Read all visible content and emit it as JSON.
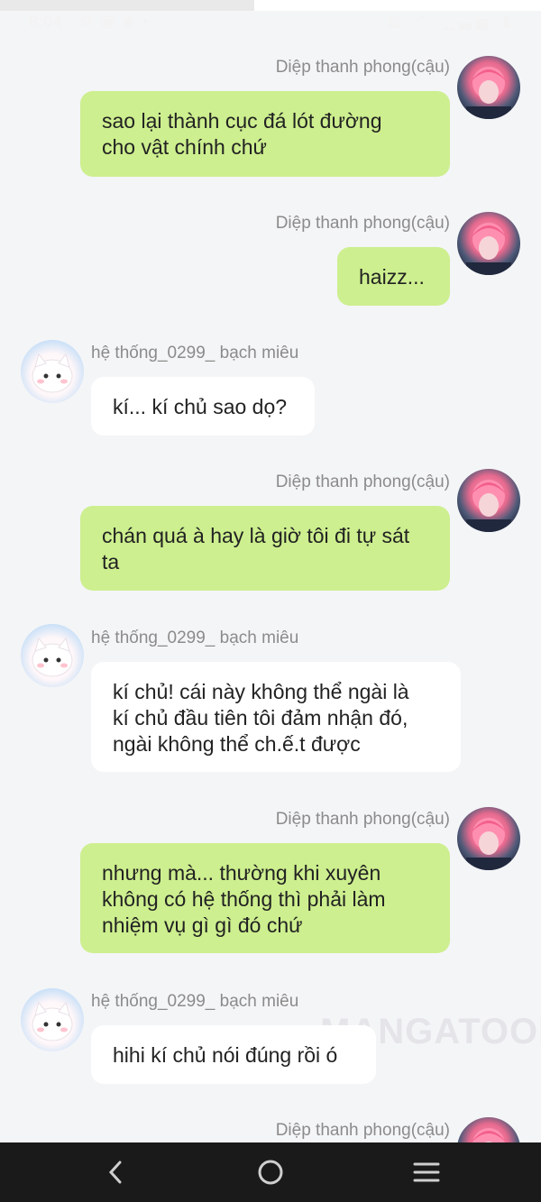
{
  "status_bar": {
    "time": "8:04"
  },
  "messages": [
    {
      "sender": "Diệp thanh phong(cậu)",
      "side": "right",
      "avatar": "boy-avatar",
      "text": "sao lại thành cục đá lót đường cho vật chính chứ",
      "lines": [
        "sao lại thành cục đá lót đường",
        "cho vật chính chứ"
      ]
    },
    {
      "sender": "Diệp thanh phong(cậu)",
      "side": "right",
      "avatar": "boy-avatar",
      "text": "haizz...",
      "lines": [
        "haizz..."
      ]
    },
    {
      "sender": "hệ thống_0299_ bạch miêu",
      "side": "left",
      "avatar": "cat-avatar",
      "text": "kí... kí chủ sao dọ?",
      "lines": [
        "kí... kí chủ sao dọ?"
      ]
    },
    {
      "sender": "Diệp thanh phong(cậu)",
      "side": "right",
      "avatar": "boy-avatar",
      "text": "chán quá à hay là giờ tôi đi tự sát ta",
      "lines": [
        "chán quá à hay là giờ tôi đi tự sát",
        "ta"
      ]
    },
    {
      "sender": "hệ thống_0299_ bạch miêu",
      "side": "left",
      "avatar": "cat-avatar",
      "text": "kí chủ! cái này không thể ngài là kí chủ đầu tiên tôi đảm nhận đó, ngài không thể ch.ế.t được",
      "lines": [
        "kí chủ! cái này không thể ngài là",
        "kí chủ đầu tiên tôi đảm nhận đó,",
        "ngài không thể ch.ế.t được"
      ]
    },
    {
      "sender": "Diệp thanh phong(cậu)",
      "side": "right",
      "avatar": "boy-avatar",
      "text": "nhưng mà... thường khi xuyên không có hệ thống thì phải làm nhiệm vụ gì gì đó chứ",
      "lines": [
        "nhưng mà... thường khi xuyên",
        "không có hệ thống thì phải làm",
        "nhiệm vụ gì gì đó chứ"
      ]
    },
    {
      "sender": "hệ thống_0299_ bạch miêu",
      "side": "left",
      "avatar": "cat-avatar",
      "text": "hihi kí chủ nói đúng rồi ó",
      "lines": [
        "hihi kí chủ nói đúng rồi ó"
      ]
    },
    {
      "sender": "Diệp thanh phong(cậu)",
      "side": "right",
      "avatar": "boy-avatar",
      "text": "",
      "lines": []
    }
  ],
  "watermark": "MANGATOON",
  "colors": {
    "my_bubble": "#cdef8f",
    "their_bubble": "#ffffff",
    "background": "#f4f5f7",
    "nav_bar": "#1a1a1a"
  },
  "nav_bar": {
    "back_icon": "chevron-left-icon",
    "home_icon": "circle-home-icon",
    "menu_icon": "hamburger-menu-icon"
  }
}
